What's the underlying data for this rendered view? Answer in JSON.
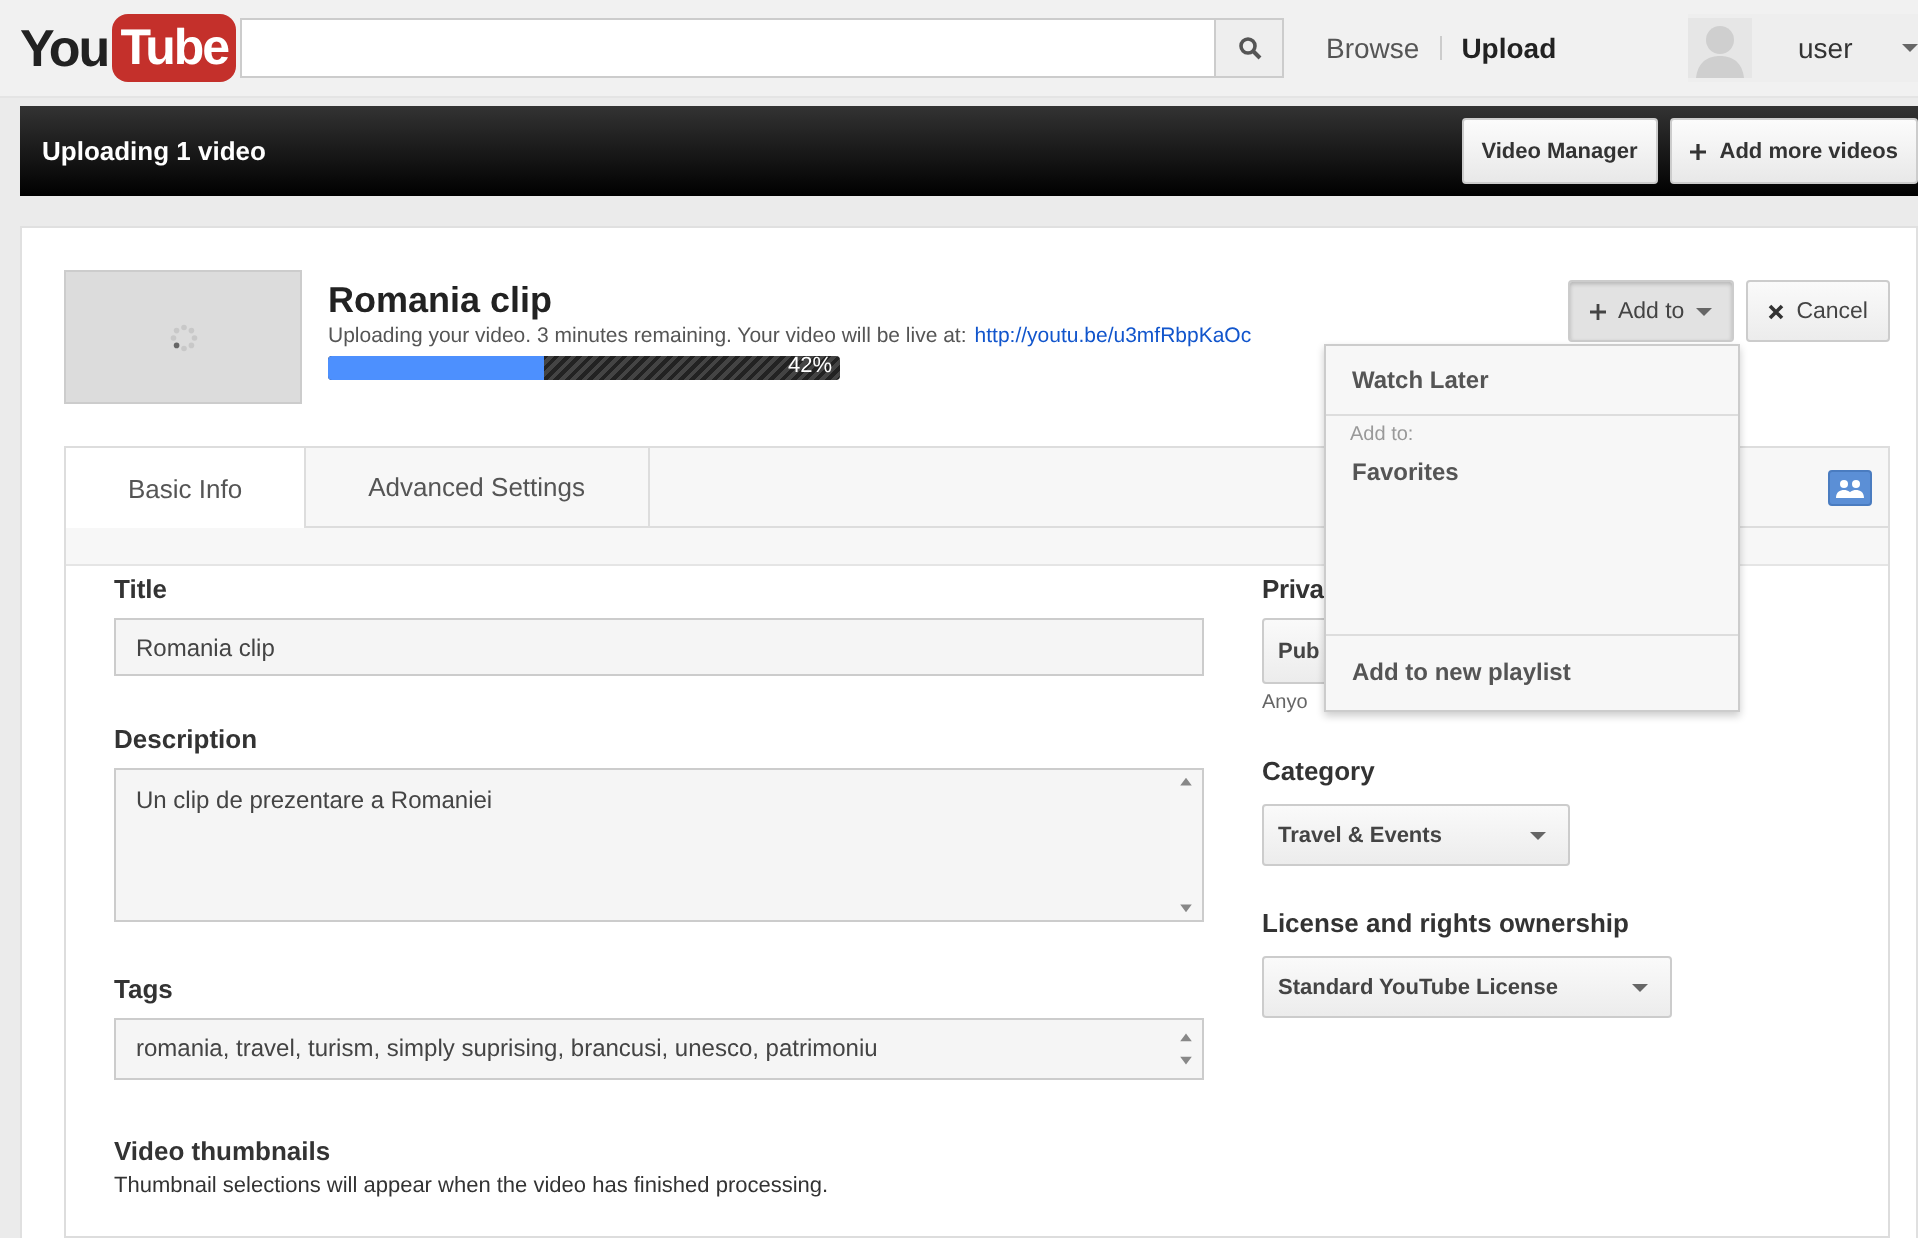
{
  "header": {
    "logo": {
      "first": "You",
      "second": "Tube"
    },
    "nav": [
      {
        "label": "Browse",
        "selected": false
      },
      {
        "label": "Upload",
        "selected": true
      }
    ],
    "user": "user"
  },
  "upload_bar": {
    "title": "Uploading 1 video",
    "buttons": [
      {
        "label": "Video Manager",
        "kind": "plain"
      },
      {
        "label": "Add more videos",
        "kind": "plus"
      }
    ]
  },
  "video": {
    "title": "Romania clip",
    "status": "Uploading your video. 3 minutes remaining. Your video will be live at:",
    "link": "http://youtu.be/u3mfRbpKaOc",
    "progress": {
      "level": 0.42,
      "reading": "42%"
    },
    "add_to": {
      "label": "Add to",
      "expanded": true
    },
    "cancel": "Cancel"
  },
  "menu": {
    "top_item": "Watch Later",
    "section_label": "Add to:",
    "items": [
      "Favorites"
    ],
    "footer_item": "Add to new playlist"
  },
  "tabs": [
    {
      "label": "Basic Info",
      "selected": true
    },
    {
      "label": "Advanced Settings",
      "selected": false
    }
  ],
  "form": {
    "title": {
      "label": "Title",
      "value": "Romania clip"
    },
    "description": {
      "label": "Description",
      "value": "Un clip de prezentare a Romaniei"
    },
    "tags": {
      "label": "Tags",
      "value": "romania, travel, turism, simply suprising, brancusi, unesco, patrimoniu"
    },
    "thumbnails": {
      "label": "Video thumbnails",
      "note": "Thumbnail selections will appear when the video has finished processing."
    }
  },
  "side": {
    "privacy": {
      "label": "Priva",
      "value": "Pub",
      "note": "Anyo"
    },
    "category": {
      "label": "Category",
      "value": "Travel & Events"
    },
    "license": {
      "label": "License and rights ownership",
      "value": "Standard YouTube License"
    }
  }
}
